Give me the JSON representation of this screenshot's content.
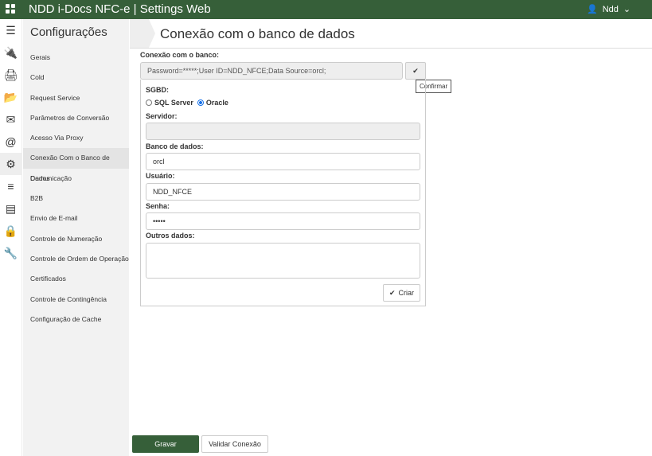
{
  "app": {
    "title": "NDD i-Docs NFC-e | Settings Web",
    "user": "Ndd"
  },
  "iconbar": [
    "menu-icon",
    "plug-icon",
    "print-icon",
    "folder-open-icon",
    "envelope-icon",
    "at-icon",
    "gear-icon",
    "sliders-icon",
    "server-icon",
    "lock-icon",
    "wrench-icon"
  ],
  "sidebar": {
    "title": "Configurações",
    "items": [
      "Gerais",
      "Cold",
      "Request Service",
      "Parâmetros de Conversão",
      "Acesso Via Proxy",
      "Conexão Com o Banco de Dados",
      "Comunicação",
      "B2B",
      "Envio de E-mail",
      "Controle de Numeração",
      "Controle de Ordem de Operação",
      "Certificados",
      "Controle de Contingência",
      "Configuração de Cache"
    ],
    "active": "Conexão Com o Banco de Dados"
  },
  "page": {
    "title": "Conexão com o banco de dados"
  },
  "form": {
    "connection_label": "Conexão com o banco:",
    "connection_value": "Password=*****;User ID=NDD_NFCE;Data Source=orcl;",
    "confirm_tooltip": "Confirmar",
    "sgbd_label": "SGBD:",
    "sgbd_options": [
      "SQL Server",
      "Oracle"
    ],
    "sgbd_selected": "Oracle",
    "server_label": "Servidor:",
    "server_value": "",
    "database_label": "Banco de dados:",
    "database_value": "orcl",
    "user_label": "Usuário:",
    "user_value": "NDD_NFCE",
    "password_label": "Senha:",
    "password_value": "•••••",
    "other_label": "Outros dados:",
    "other_value": "",
    "create_label": "Criar"
  },
  "footer": {
    "save_label": "Gravar",
    "validate_label": "Validar Conexão"
  },
  "colors": {
    "brand": "#365f39"
  }
}
